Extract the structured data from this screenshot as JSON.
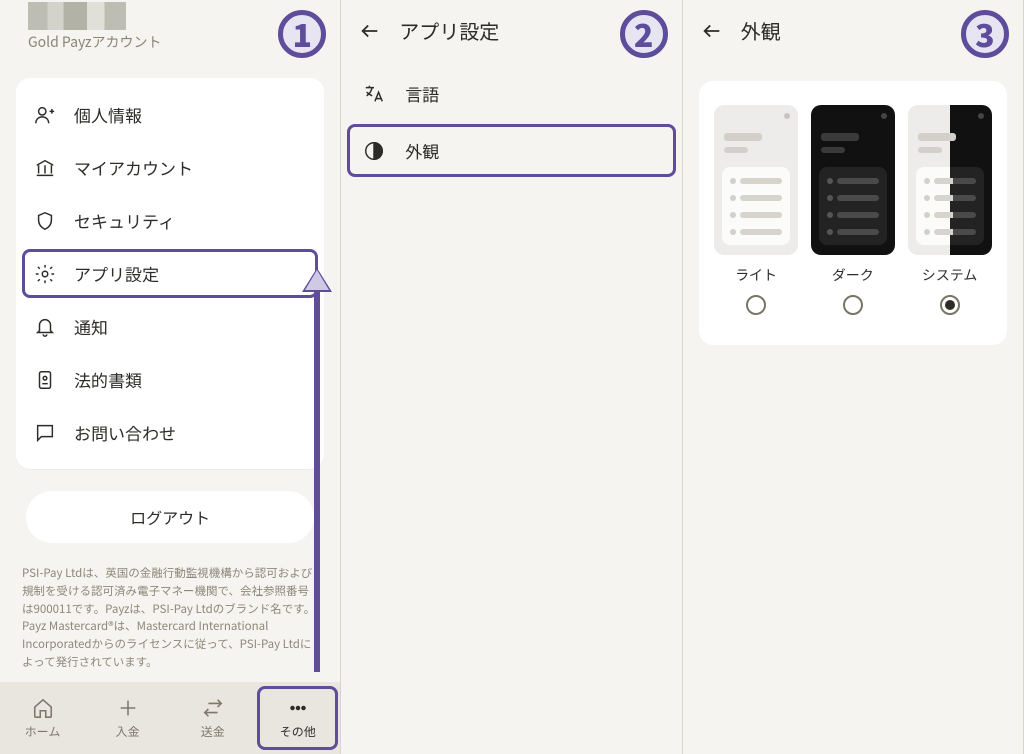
{
  "badges": {
    "1": "1",
    "2": "2",
    "3": "3"
  },
  "pane1": {
    "account_line": "Gold Payzアカウント",
    "menu": {
      "personal": "個人情報",
      "account": "マイアカウント",
      "security": "セキュリティ",
      "settings": "アプリ設定",
      "notify": "通知",
      "legal": "法的書類",
      "contact": "お問い合わせ"
    },
    "logout": "ログアウト",
    "legal_text": "PSI-Pay Ltdは、英国の金融行動監視機構から認可および規制を受ける認可済み電子マネー機関で、会社参照番号は900011です。Payzは、PSI-Pay Ltdのブランド名です。 Payz Mastercard®は、Mastercard International Incorporatedからのライセンスに従って、PSI-Pay Ltdによって発行されています。",
    "tabs": {
      "home": "ホーム",
      "deposit": "入金",
      "send": "送金",
      "more": "その他"
    }
  },
  "pane2": {
    "title": "アプリ設定",
    "rows": {
      "language": "言語",
      "appearance": "外観"
    }
  },
  "pane3": {
    "title": "外観",
    "themes": {
      "light": "ライト",
      "dark": "ダーク",
      "system": "システム"
    },
    "selected": "system"
  }
}
